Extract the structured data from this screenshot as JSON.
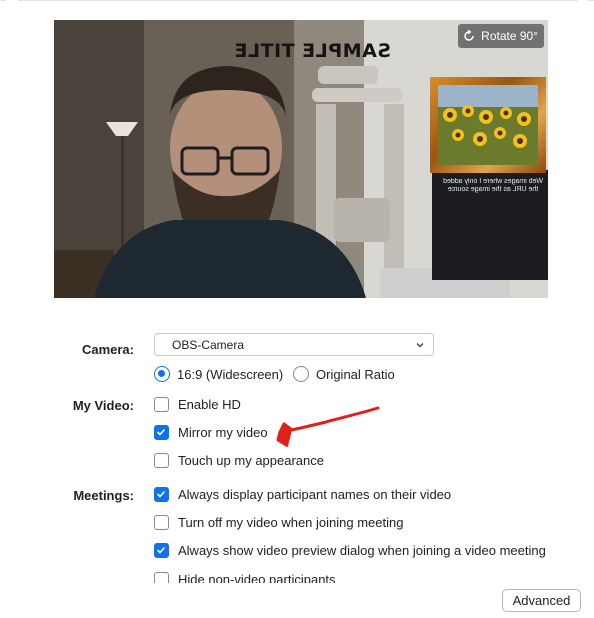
{
  "preview": {
    "rotate_label": "Rotate 90°",
    "overlay_title": "SAMPLE TITLE",
    "frame_caption": "Web images where I only added the URL as the image source"
  },
  "camera": {
    "label": "Camera:",
    "selected": "OBS-Camera",
    "ratio_options": [
      {
        "label": "16:9 (Widescreen)",
        "checked": true
      },
      {
        "label": "Original Ratio",
        "checked": false
      }
    ]
  },
  "my_video": {
    "label": "My Video:",
    "options": [
      {
        "label": "Enable HD",
        "checked": false
      },
      {
        "label": "Mirror my video",
        "checked": true
      },
      {
        "label": "Touch up my appearance",
        "checked": false
      }
    ]
  },
  "meetings": {
    "label": "Meetings:",
    "options": [
      {
        "label": "Always display participant names on their video",
        "checked": true
      },
      {
        "label": "Turn off my video when joining meeting",
        "checked": false
      },
      {
        "label": "Always show video preview dialog when joining a video meeting",
        "checked": true
      },
      {
        "label": "Hide non-video participants",
        "checked": false
      }
    ]
  },
  "advanced_label": "Advanced",
  "colors": {
    "accent": "#0e72ed",
    "annotation": "#e0201b"
  }
}
